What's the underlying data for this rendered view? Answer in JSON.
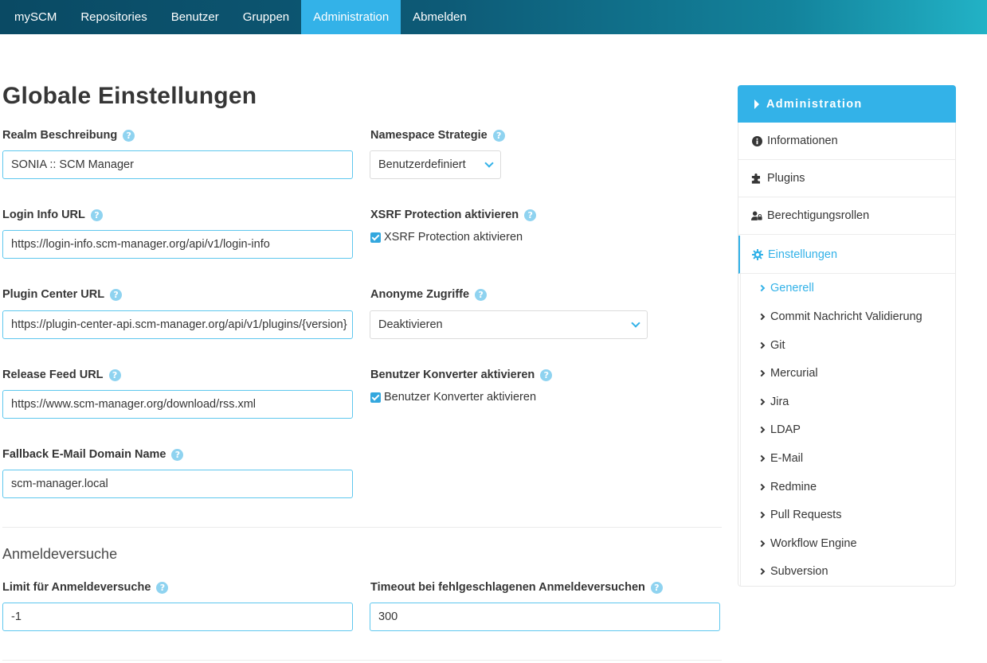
{
  "nav": {
    "items": [
      {
        "label": "mySCM"
      },
      {
        "label": "Repositories"
      },
      {
        "label": "Benutzer"
      },
      {
        "label": "Gruppen"
      },
      {
        "label": "Administration",
        "active": true
      },
      {
        "label": "Abmelden"
      }
    ]
  },
  "page": {
    "title": "Globale Einstellungen"
  },
  "form": {
    "realm": {
      "label": "Realm Beschreibung",
      "value": "SONIA :: SCM Manager"
    },
    "namespace": {
      "label": "Namespace Strategie",
      "value": "Benutzerdefiniert"
    },
    "login_info": {
      "label": "Login Info URL",
      "value": "https://login-info.scm-manager.org/api/v1/login-info"
    },
    "xsrf": {
      "label": "XSRF Protection aktivieren",
      "checkbox_label": "XSRF Protection aktivieren",
      "checked": true
    },
    "plugin_center": {
      "label": "Plugin Center URL",
      "value": "https://plugin-center-api.scm-manager.org/api/v1/plugins/{version}"
    },
    "anonymous": {
      "label": "Anonyme Zugriffe",
      "value": "Deaktivieren"
    },
    "release_feed": {
      "label": "Release Feed URL",
      "value": "https://www.scm-manager.org/download/rss.xml"
    },
    "user_converter": {
      "label": "Benutzer Konverter aktivieren",
      "checkbox_label": "Benutzer Konverter aktivieren",
      "checked": true
    },
    "fallback_mail": {
      "label": "Fallback E-Mail Domain Name",
      "value": "scm-manager.local"
    }
  },
  "login_attempts": {
    "section_title": "Anmeldeversuche",
    "limit": {
      "label": "Limit für Anmeldeversuche",
      "value": "-1"
    },
    "timeout": {
      "label": "Timeout bei fehlgeschlagenen Anmeldeversuchen",
      "value": "300"
    }
  },
  "sidebar": {
    "header": "Administration",
    "items": [
      {
        "label": "Informationen",
        "icon": "info-circle-icon"
      },
      {
        "label": "Plugins",
        "icon": "puzzle-icon"
      },
      {
        "label": "Berechtigungsrollen",
        "icon": "user-lock-icon"
      },
      {
        "label": "Einstellungen",
        "icon": "gear-icon",
        "active": true
      }
    ],
    "subitems": [
      {
        "label": "Generell",
        "active": true
      },
      {
        "label": "Commit Nachricht Validierung"
      },
      {
        "label": "Git"
      },
      {
        "label": "Mercurial"
      },
      {
        "label": "Jira"
      },
      {
        "label": "LDAP"
      },
      {
        "label": "E-Mail"
      },
      {
        "label": "Redmine"
      },
      {
        "label": "Pull Requests"
      },
      {
        "label": "Workflow Engine"
      },
      {
        "label": "Subversion"
      }
    ]
  },
  "colors": {
    "accent": "#33b2e8",
    "nav_dark": "#0a4a64",
    "text": "#363636"
  }
}
